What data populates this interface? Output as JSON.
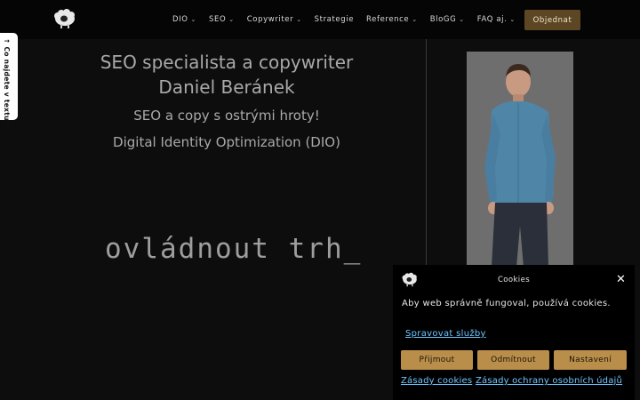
{
  "header": {
    "logo": "sheep-logo-icon",
    "nav": [
      {
        "label": "DIO",
        "has_dropdown": true
      },
      {
        "label": "SEO",
        "has_dropdown": true
      },
      {
        "label": "Copywriter",
        "has_dropdown": true
      },
      {
        "label": "Strategie",
        "has_dropdown": false
      },
      {
        "label": "Reference",
        "has_dropdown": true
      },
      {
        "label": "BloGG",
        "has_dropdown": true
      },
      {
        "label": "FAQ aj.",
        "has_dropdown": true
      }
    ],
    "order_button": "Objednat",
    "chevron": "⌄"
  },
  "side_tab": {
    "label": "↑ Co najdete v textu?"
  },
  "hero": {
    "title_line1": "SEO specialista a copywriter",
    "title_line2": "Daniel Beránek",
    "subtitle": "SEO a copy s ostrými hroty!",
    "subtitle2": "Digital Identity Optimization (DIO)",
    "typed_text": "ovládnout trh_"
  },
  "cookie": {
    "title": "Cookies",
    "close_symbol": "✕",
    "message": "Aby web správně fungoval, používá cookies.",
    "manage_link": "Spravovat služby",
    "accept": "Přijmout",
    "reject": "Odmítnout",
    "settings": "Nastavení",
    "policy_link": "Zásady cookies",
    "privacy_link": "Zásady ochrany osobních údajů"
  },
  "colors": {
    "background": "#0d0d0d",
    "header": "#050505",
    "order_button": "#5c4623",
    "cookie_button": "#b98e4a",
    "link": "#6ec6ff"
  }
}
